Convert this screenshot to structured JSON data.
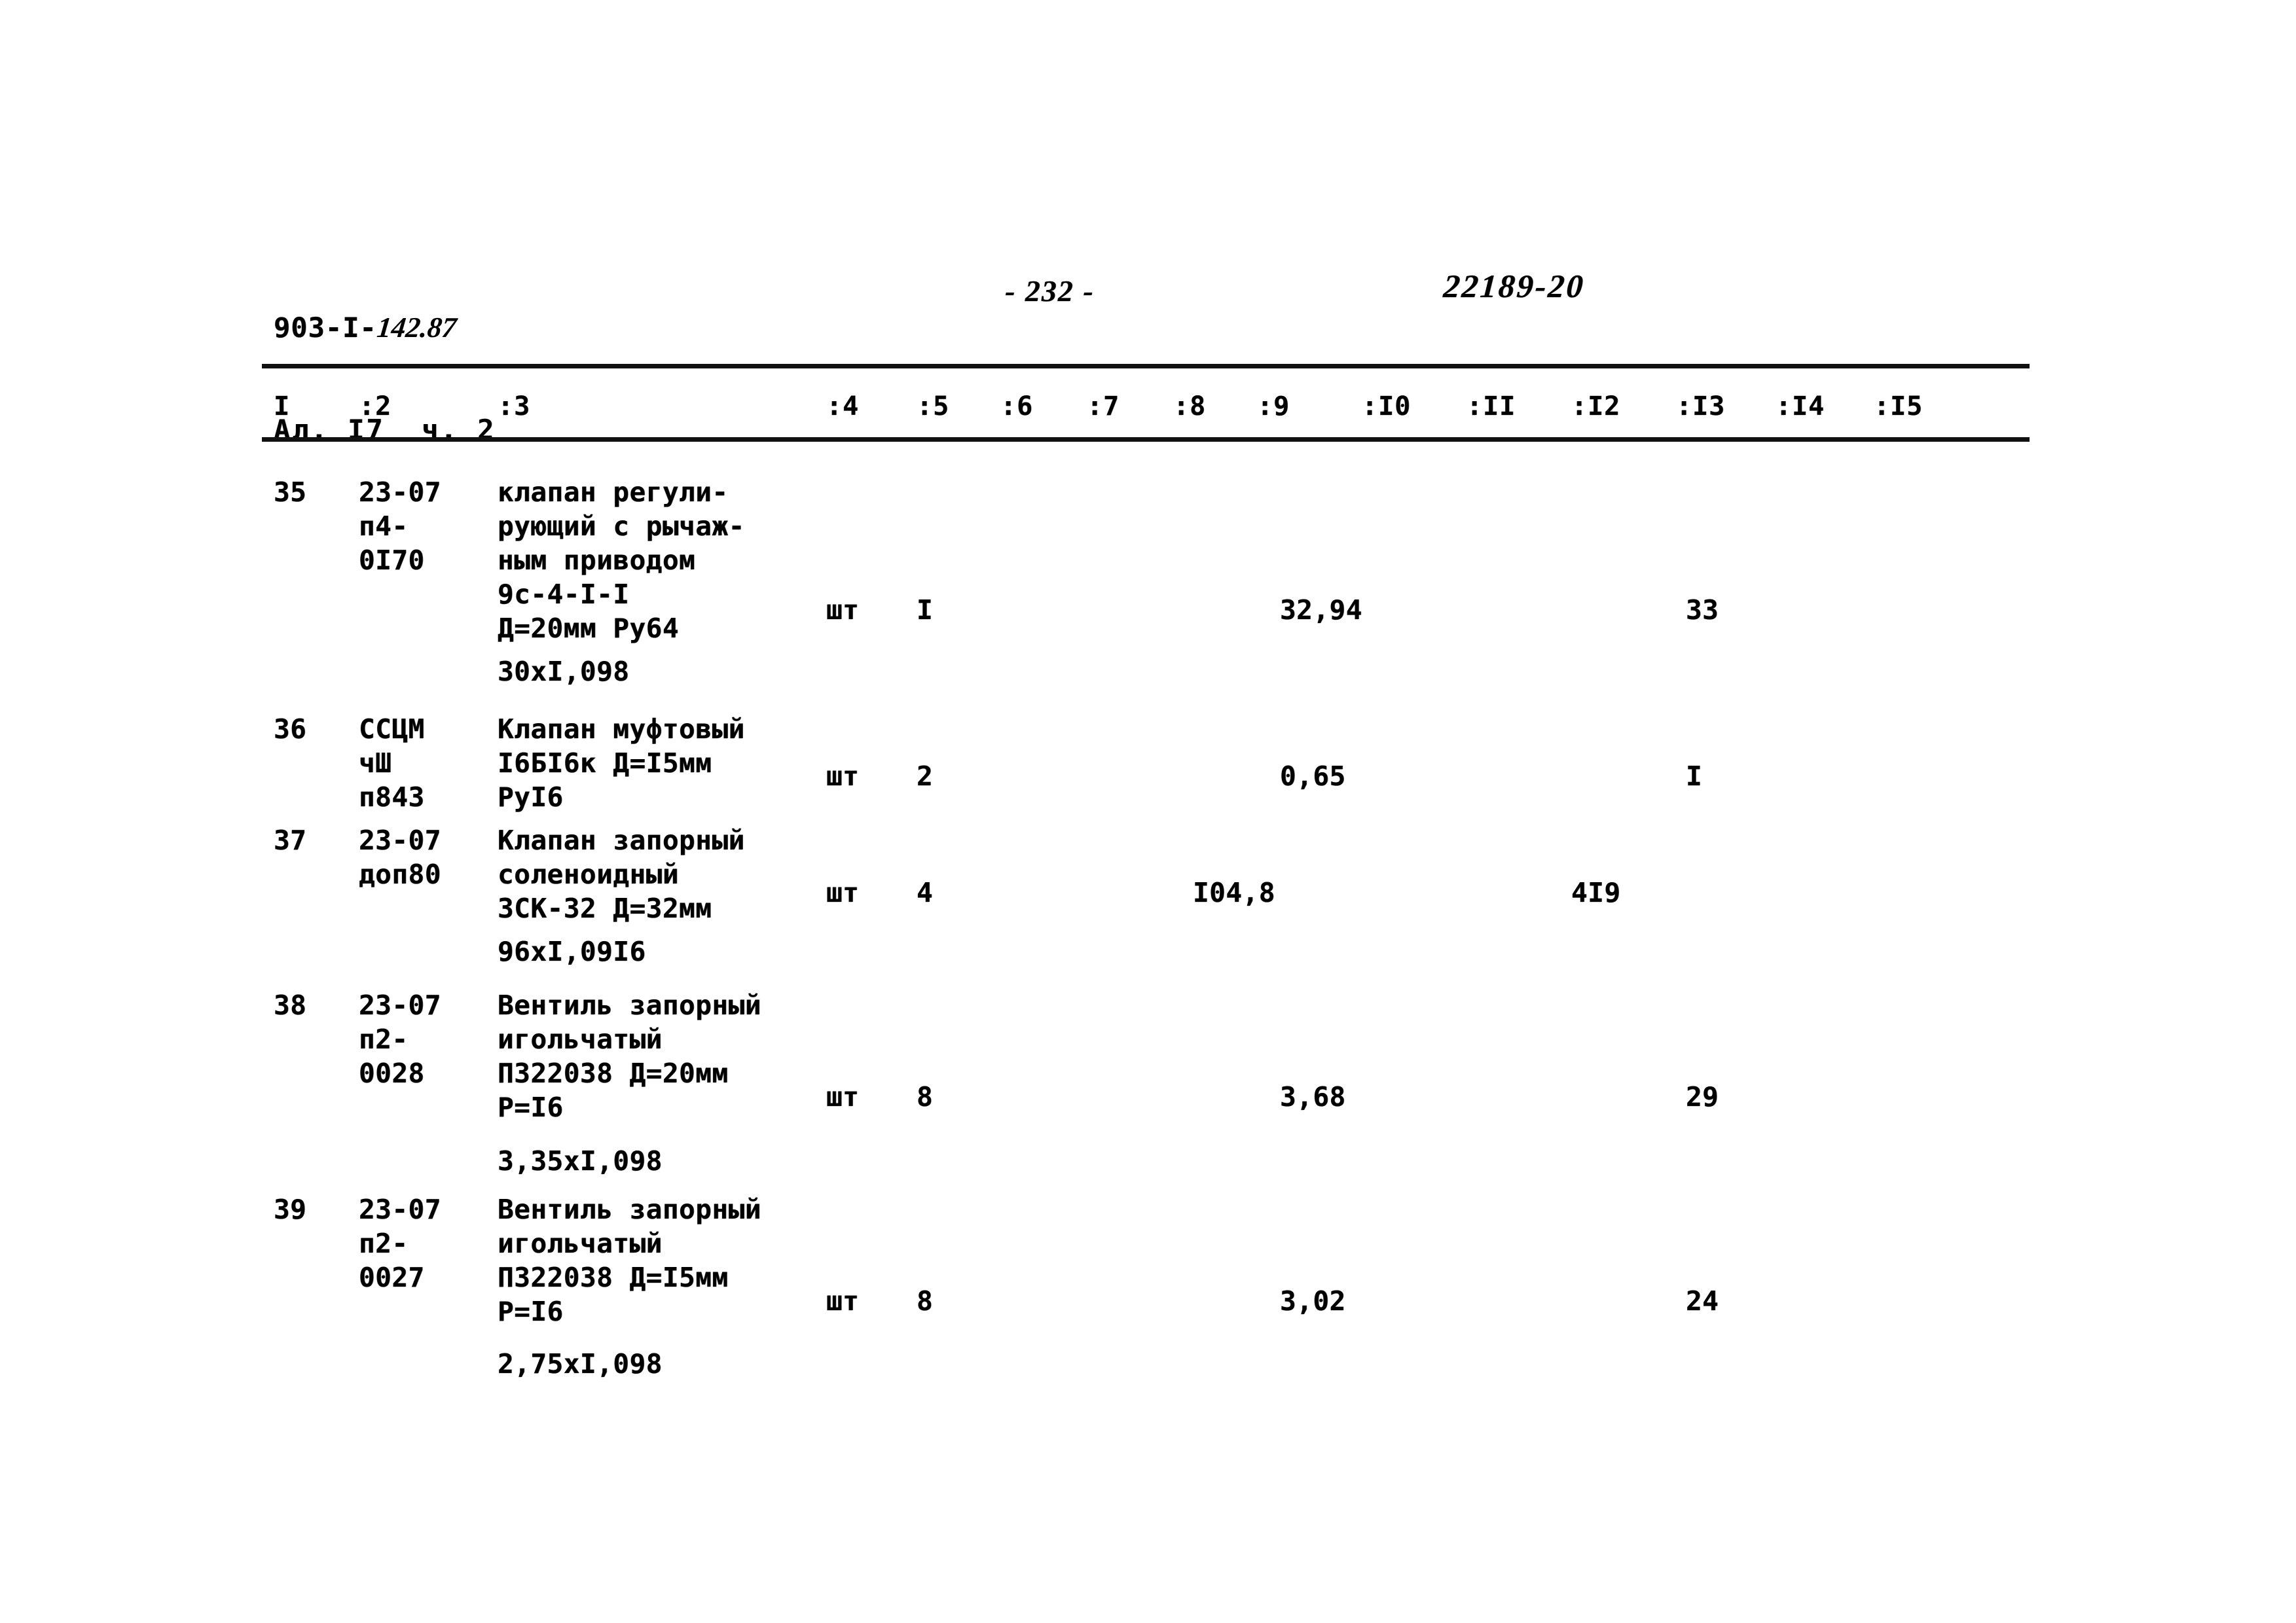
{
  "header": {
    "doc_code_printed": "903-I-",
    "doc_code_hand": "142.87",
    "album_line": "Ал. I7  ч. 2",
    "page_number": "- 232 -",
    "stamp": "22189-20"
  },
  "table": {
    "columns": [
      "I",
      ":2",
      ":3",
      ":4",
      ":5",
      ":6",
      ":7",
      ":8",
      ":9",
      ":I0",
      ":II",
      ":I2",
      ":I3",
      ":I4",
      ":I5"
    ],
    "rows": [
      {
        "num": "35",
        "code": "23-07\nп4-\n0I70",
        "desc": "клапан регули-\nрующий с рычаж-\nным приводом\n9с-4-I-I\nД=20мм Ру64",
        "unit": "шт",
        "qty": "I",
        "col8": "",
        "col9": "32,94",
        "col12": "",
        "col13": "33",
        "formula": "30xI,098"
      },
      {
        "num": "36",
        "code": "ССЦМ\nчШ\nп843",
        "desc": "Клапан муфтовый\nI6БI6к Д=I5мм\nРуI6",
        "unit": "шт",
        "qty": "2",
        "col8": "",
        "col9": "0,65",
        "col12": "",
        "col13": "I",
        "formula": ""
      },
      {
        "num": "37",
        "code": "23-07\nдоп80",
        "desc": "Клапан запорный\nсоленоидный\nЗСК-32 Д=32мм",
        "unit": "шт",
        "qty": "4",
        "col8": "I04,8",
        "col9": "",
        "col12": "4I9",
        "col13": "",
        "formula": "96xI,09I6"
      },
      {
        "num": "38",
        "code": "23-07\nп2-\n0028",
        "desc": "Вентиль запорный\nигольчатый\nП322038 Д=20мм\nР=I6",
        "unit": "шт",
        "qty": "8",
        "col8": "",
        "col9": "3,68",
        "col12": "",
        "col13": "29",
        "formula": "3,35xI,098"
      },
      {
        "num": "39",
        "code": "23-07\nп2-\n0027",
        "desc": "Вентиль запорный\nигольчатый\nП322038 Д=I5мм\nР=I6",
        "unit": "шт",
        "qty": "8",
        "col8": "",
        "col9": "3,02",
        "col12": "",
        "col13": "24",
        "formula": "2,75xI,098"
      }
    ]
  }
}
